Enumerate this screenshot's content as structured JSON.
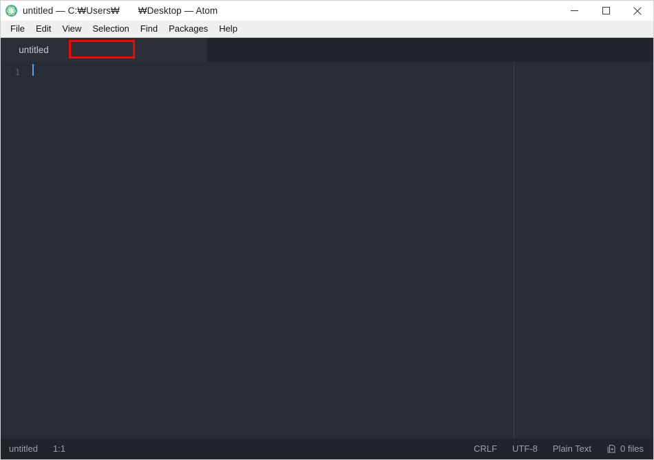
{
  "window": {
    "title": "untitled — C:₩Users₩       ₩Desktop — Atom",
    "app_icon": "atom-logo-icon",
    "controls": {
      "minimize": "minimize-icon",
      "maximize": "maximize-icon",
      "close": "close-icon"
    }
  },
  "menu": {
    "items": [
      {
        "label": "File"
      },
      {
        "label": "Edit"
      },
      {
        "label": "View"
      },
      {
        "label": "Selection"
      },
      {
        "label": "Find"
      },
      {
        "label": "Packages"
      },
      {
        "label": "Help"
      }
    ]
  },
  "tabs": [
    {
      "label": "untitled",
      "active": true
    }
  ],
  "annotation": {
    "type": "highlight-rectangle",
    "color": "#ff0000",
    "target": "untitled tab"
  },
  "editor": {
    "lines": [
      {
        "number": "1",
        "text": ""
      }
    ],
    "cursor": {
      "visible": true
    }
  },
  "status_bar": {
    "left": [
      {
        "name": "file-name",
        "label": "untitled"
      },
      {
        "name": "cursor-position",
        "label": "1:1"
      }
    ],
    "right": [
      {
        "name": "line-ending",
        "label": "CRLF"
      },
      {
        "name": "encoding",
        "label": "UTF-8"
      },
      {
        "name": "grammar",
        "label": "Plain Text"
      }
    ],
    "files": {
      "icon": "file-diff-icon",
      "label": "0 files"
    }
  },
  "colors": {
    "title_bar_bg": "#ffffff",
    "menu_bar_bg": "#efefef",
    "tab_bar_bg": "#21252b",
    "tab_active_bg": "#2b3038",
    "editor_bg": "#282c34",
    "status_bar_bg": "#21252b",
    "accent_cursor": "#5a9cf8",
    "annotation": "#ff0000"
  }
}
